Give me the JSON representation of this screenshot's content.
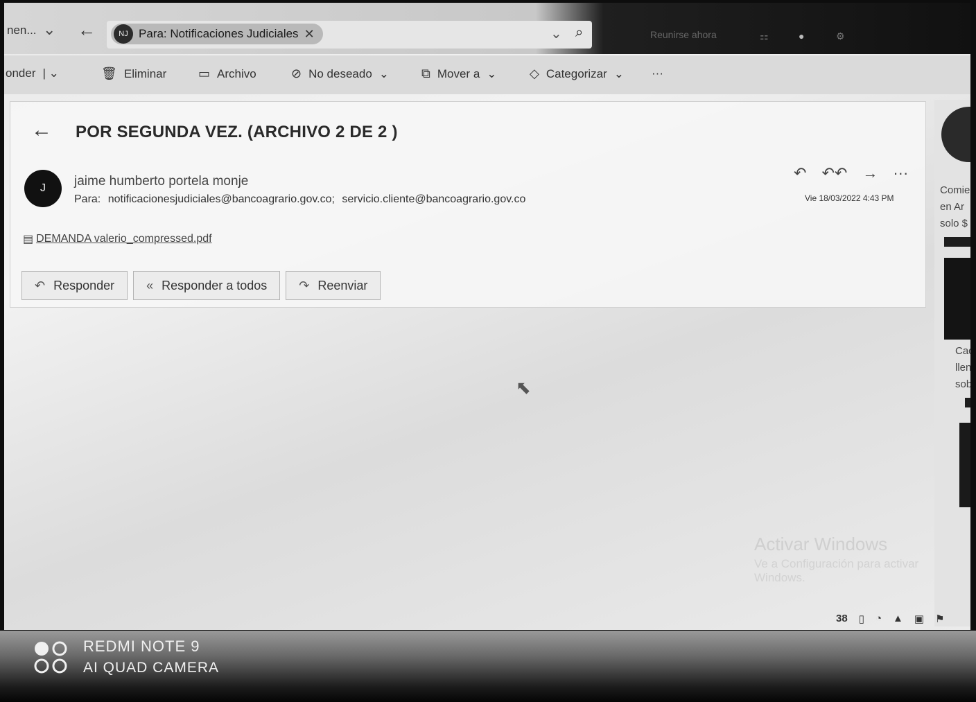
{
  "topbar": {
    "folder_crumb": "nen...",
    "search_chip_initials": "NJ",
    "search_chip_text": "Para: Notificaciones Judiciales",
    "meet_now": "Reunirse ahora"
  },
  "toolbar": {
    "reply_label": "onder",
    "delete_label": "Eliminar",
    "archive_label": "Archivo",
    "junk_label": "No deseado",
    "move_label": "Mover a",
    "categorize_label": "Categorizar",
    "more_label": "···"
  },
  "message": {
    "subject": "POR SEGUNDA VEZ. (ARCHIVO 2 DE 2 )",
    "sender_initial": "J",
    "sender_name": "jaime humberto portela monje",
    "to_label": "Para:",
    "recipients": [
      "notificacionesjudiciales@bancoagrario.gov.co;",
      "servicio.cliente@bancoagrario.gov.co"
    ],
    "date": "Vie 18/03/2022 4:43 PM",
    "attachment_name": "DEMANDA valerio_compressed.pdf"
  },
  "actions": {
    "reply": "Responder",
    "reply_all": "Responder a todos",
    "forward": "Reenviar"
  },
  "ad": {
    "text_lines": [
      "Comie",
      "en Ar",
      "solo $"
    ],
    "text_lines_2": [
      "Cac",
      "llen",
      "sob"
    ]
  },
  "watermark": {
    "title": "Activar Windows",
    "subtitle": "Ve a Configuración para activar Windows."
  },
  "tray": {
    "number": "38"
  },
  "camera": {
    "line1": "REDMI NOTE 9",
    "line2": "AI QUAD CAMERA"
  }
}
